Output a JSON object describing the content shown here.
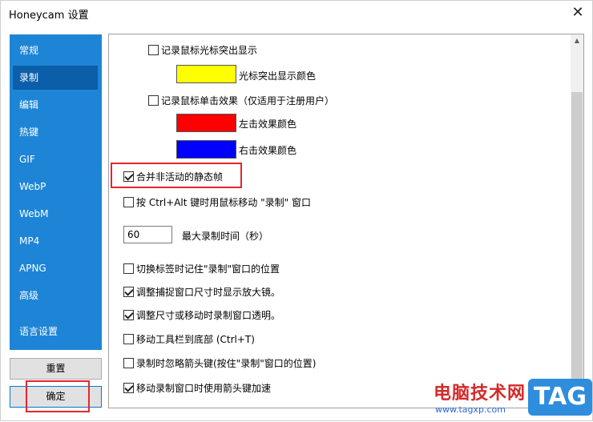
{
  "window": {
    "title": "Honeycam 设置",
    "close_glyph": "✕"
  },
  "sidebar": {
    "items": [
      {
        "label": "常规"
      },
      {
        "label": "录制"
      },
      {
        "label": "编辑"
      },
      {
        "label": "热键"
      },
      {
        "label": "GIF"
      },
      {
        "label": "WebP"
      },
      {
        "label": "WebM"
      },
      {
        "label": "MP4"
      },
      {
        "label": "APNG"
      },
      {
        "label": "高级"
      },
      {
        "label": "语言设置"
      }
    ],
    "active": "录制"
  },
  "buttons": {
    "reset": "重置",
    "ok": "确定"
  },
  "options": {
    "cursor_highlight": {
      "label": "记录鼠标光标突出显示",
      "checked": false
    },
    "cursor_color": {
      "label": "光标突出显示颜色",
      "color": "#ffff00"
    },
    "click_effect": {
      "label": "记录鼠标单击效果（仅适用于注册用户）",
      "checked": false
    },
    "left_click_color": {
      "label": "左击效果颜色",
      "color": "#ff0000"
    },
    "right_click_color": {
      "label": "右击效果颜色",
      "color": "#0000ff"
    },
    "merge_frames": {
      "label": "合并非活动的静态帧",
      "checked": true
    },
    "ctrl_alt_move": {
      "label": "按 Ctrl+Alt 键时用鼠标移动 \"录制\" 窗口",
      "checked": false
    },
    "max_time": {
      "value": "60",
      "label": "最大录制时间（秒）"
    },
    "remember_pos": {
      "label": "切换标签时记住\"录制\"窗口的位置",
      "checked": false
    },
    "magnifier": {
      "label": "调整捕捉窗口尺寸时显示放大镜。",
      "checked": true
    },
    "transparent": {
      "label": "调整尺寸或移动时录制窗口透明。",
      "checked": true
    },
    "toolbar_bottom": {
      "label": "移动工具栏到底部 (Ctrl+T)",
      "checked": false
    },
    "ignore_arrows": {
      "label": "录制时忽略箭头键(按住\"录制\"窗口的位置)",
      "checked": false
    },
    "accel_arrows": {
      "label": "移动录制窗口时使用箭头键加速",
      "checked": true
    }
  },
  "watermark": {
    "text": "电脑技术网",
    "url": "www.tagxp.com",
    "tag": "TAG"
  },
  "colors": {
    "sidebar_bg": "#1e85d6",
    "sidebar_active": "#0c5ea8",
    "highlight_box": "#e6262a"
  }
}
